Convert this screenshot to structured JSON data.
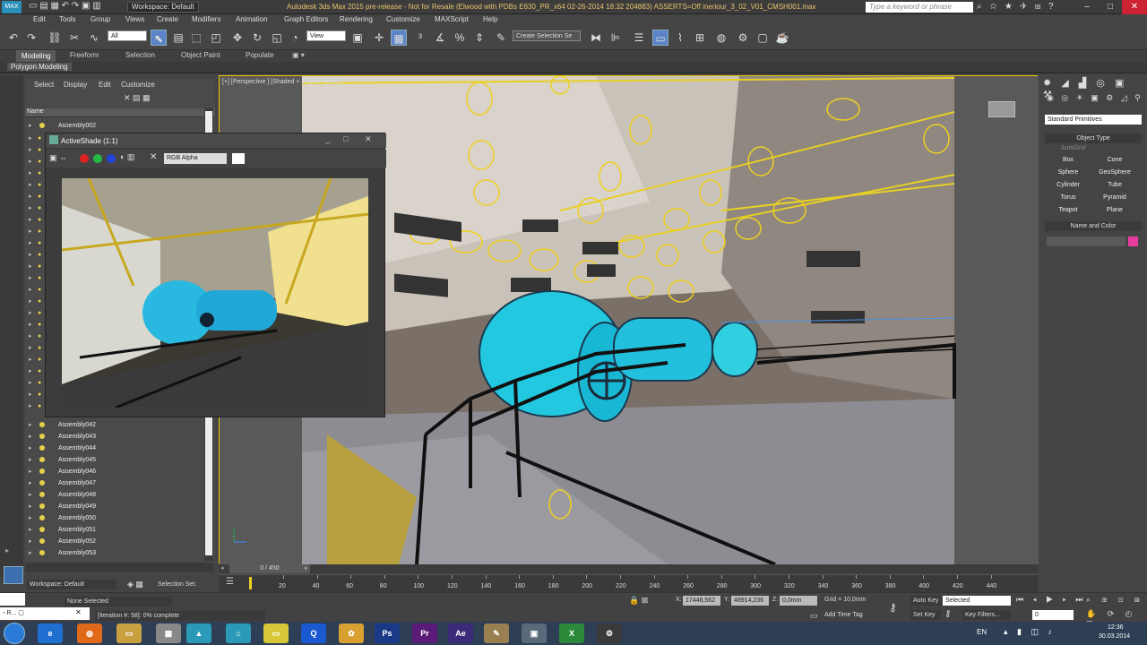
{
  "app": {
    "title": "Autodesk 3ds Max  2015 pre-release - Not for Resale (Elwood with PDBs E630_PR_x64 02-26-2014 18:32 204883) ASSERTS=Off    ineriour_3_02_V01_CMSH001.max",
    "workspace": "Workspace: Default",
    "keyword_placeholder": "Type a keyword or phrase"
  },
  "menus": [
    "Edit",
    "Tools",
    "Group",
    "Views",
    "Create",
    "Modifiers",
    "Animation",
    "Graph Editors",
    "Rendering",
    "Customize",
    "MAXScript",
    "Help"
  ],
  "toolbar": {
    "filter": "All",
    "refcoord": "View",
    "selection_set": "Create Selection Se"
  },
  "ribbon": {
    "tabs": [
      "Modeling",
      "Freeform",
      "Selection",
      "Object Paint",
      "Populate"
    ],
    "active_tab": "Modeling",
    "sub": "Polygon Modeling"
  },
  "scene_explorer": {
    "menu": [
      "Select",
      "Display",
      "Edit",
      "Customize"
    ],
    "column": "Name",
    "items_top": [
      "Assembly002"
    ],
    "items_bottom": [
      "Assembly042",
      "Assembly043",
      "Assembly044",
      "Assembly045",
      "Assembly046",
      "Assembly047",
      "Assembly048",
      "Assembly049",
      "Assembly050",
      "Assembly051",
      "Assembly052",
      "Assembly053"
    ]
  },
  "viewport": {
    "label": "[+] [Perspective ] [Shaded + Edged Faces ]"
  },
  "activeshade": {
    "title": "ActiveShade (1:1)",
    "channel": "RGB Alpha"
  },
  "command_panel": {
    "category": "Standard Primitives",
    "object_type_title": "Object Type",
    "autogrid": "AutoGrid",
    "buttons": [
      "Box",
      "Cone",
      "Sphere",
      "GeoSphere",
      "Cylinder",
      "Tube",
      "Torus",
      "Pyramid",
      "Teapot",
      "Plane"
    ],
    "name_color_title": "Name and Color",
    "color_swatch": "#e83ba0"
  },
  "timeline": {
    "counter": "0 / 450",
    "ticks": [
      "20",
      "40",
      "60",
      "80",
      "100",
      "120",
      "140",
      "160",
      "180",
      "200",
      "220",
      "240",
      "260",
      "280",
      "300",
      "320",
      "340",
      "360",
      "380",
      "400",
      "420",
      "440"
    ]
  },
  "status": {
    "workspace": "Workspace: Default",
    "selection_set_label": "Selection Set:",
    "none_selected": "None Selected",
    "iteration": "[Iteration #: 58]: 0% complete",
    "x": "17446,562",
    "y": "48914,236",
    "z": "0,0mm",
    "grid": "Grid = 10,0mm",
    "add_time_tag": "Add Time Tag",
    "auto_key": "Auto Key",
    "auto_key_value": "Selected",
    "set_key": "Set Key",
    "key_filters": "Key Filters...",
    "frame": "0"
  },
  "taskbar": {
    "lang": "EN",
    "time": "12:36",
    "date": "30.03.2014"
  }
}
